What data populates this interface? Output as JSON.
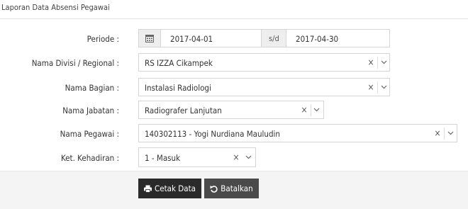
{
  "panel": {
    "title": "Laporan Data Absensi Pegawai"
  },
  "form": {
    "periode": {
      "label": "Periode :",
      "from": "2017-04-01",
      "separator": "s/d",
      "to": "2017-04-30"
    },
    "divisi": {
      "label": "Nama Divisi / Regional :",
      "value": "RS IZZA Cikampek"
    },
    "bagian": {
      "label": "Nama Bagian :",
      "value": "Instalasi Radiologi"
    },
    "jabatan": {
      "label": "Nama Jabatan :",
      "value": "Radiografer Lanjutan"
    },
    "pegawai": {
      "label": "Nama Pegawai :",
      "value": "140302113 - Yogi Nurdiana Mauludin"
    },
    "kehadiran": {
      "label": "Ket. Kehadiran :",
      "value": "1 - Masuk"
    }
  },
  "actions": {
    "print_label": "Cetak Data",
    "cancel_label": "Batalkan"
  },
  "icons": {
    "calendar": "calendar-icon",
    "clear": "×",
    "print": "print-icon",
    "undo": "undo-icon"
  },
  "colors": {
    "primary_button": "#2a2a2a",
    "secondary_button": "#4a4a4a",
    "footer_bg": "#f4f4f4"
  }
}
